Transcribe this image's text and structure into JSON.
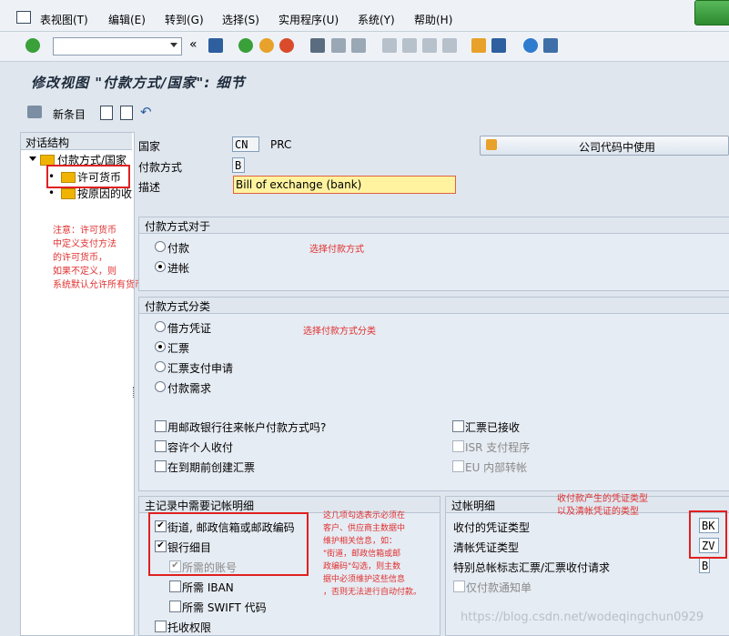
{
  "menu": [
    "表视图(T)",
    "编辑(E)",
    "转到(G)",
    "选择(S)",
    "实用程序(U)",
    "系统(Y)",
    "帮助(H)"
  ],
  "title": "修改视图 \"付款方式/国家\": 细节",
  "app_toolbar": {
    "new_entries": "新条目"
  },
  "nav": {
    "header": "对话结构",
    "items": [
      "付款方式/国家",
      "许可货币",
      "按原因的收"
    ]
  },
  "form": {
    "country_label": "国家",
    "country_value": "CN",
    "country_text": "PRC",
    "method_label": "付款方式",
    "method_value": "B",
    "desc_label": "描述",
    "desc_value": "Bill of exchange (bank)",
    "company_button": "公司代码中使用"
  },
  "group_for": {
    "title": "付款方式对于",
    "options": [
      "付款",
      "进帐"
    ],
    "selected": "进帐"
  },
  "group_class": {
    "title": "付款方式分类",
    "options": [
      "借方凭证",
      "汇票",
      "汇票支付申请",
      "付款需求"
    ],
    "selected": "汇票",
    "checks_left": [
      {
        "label": "用邮政银行往来帐户付款方式吗?",
        "checked": false,
        "disabled": false
      },
      {
        "label": "容许个人收付",
        "checked": false,
        "disabled": false
      },
      {
        "label": "在到期前创建汇票",
        "checked": false,
        "disabled": false
      }
    ],
    "checks_right": [
      {
        "label": "汇票已接收",
        "checked": false,
        "disabled": false
      },
      {
        "label": "ISR 支付程序",
        "checked": false,
        "disabled": true
      },
      {
        "label": "EU 内部转帐",
        "checked": false,
        "disabled": true
      }
    ]
  },
  "group_master": {
    "title": "主记录中需要记帐明细",
    "items": [
      {
        "label": "街道, 邮政信箱或邮政编码",
        "checked": true,
        "disabled": false
      },
      {
        "label": "银行细目",
        "checked": true,
        "disabled": false
      },
      {
        "label": "所需的账号",
        "checked": true,
        "disabled": true
      },
      {
        "label": "所需 IBAN",
        "checked": false,
        "disabled": false
      },
      {
        "label": "所需 SWIFT 代码",
        "checked": false,
        "disabled": false
      },
      {
        "label": "托收权限",
        "checked": false,
        "disabled": false
      }
    ]
  },
  "group_post": {
    "title": "过帐明细",
    "rows": [
      {
        "label": "收付的凭证类型",
        "value": "BK"
      },
      {
        "label": "清帐凭证类型",
        "value": "ZV"
      },
      {
        "label": "特别总帐标志汇票/汇票收付请求",
        "value": "B"
      }
    ],
    "check_label": "仅付款通知单"
  },
  "notes": {
    "left": "注意：许可货币\n中定义支付方法\n的许可货币，\n如果不定义，则\n系统默认允许所有货币",
    "for": "选择付款方式",
    "class": "选择付款方式分类",
    "post": "收付款产生的凭证类型\n以及清帐凭证的类型",
    "master": "这几项勾选表示必须在\n客户、供应商主数据中\n维护相关信息，如：\n\"街道，邮政信箱或邮\n政编码\"勾选，则主数\n据中必须维护这些信息\n，否则无法进行自动付款。"
  },
  "watermark": "https://blog.csdn.net/wodeqingchun0929"
}
